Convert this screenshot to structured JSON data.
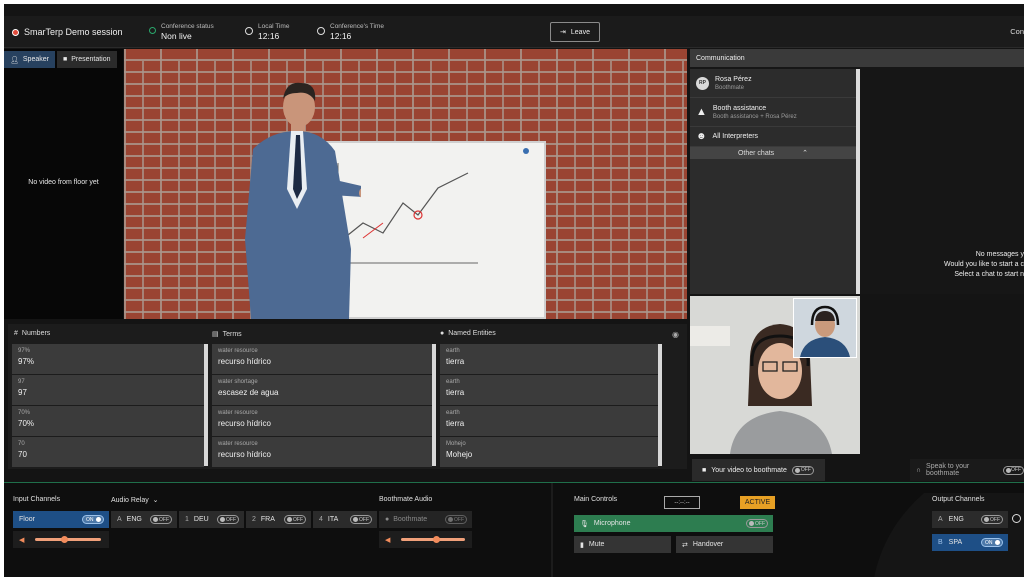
{
  "app": {
    "title": "SmarTerp Demo session"
  },
  "header": {
    "conference_status_label": "Conference status",
    "conference_status_value": "Non live",
    "local_time_label": "Local Time",
    "local_time_value": "12:16",
    "conference_time_label": "Conference's Time",
    "conference_time_value": "12:16",
    "leave_label": "Leave",
    "right_cut_label": "Con"
  },
  "left_panel": {
    "tabs": [
      {
        "label": "Speaker",
        "active": true
      },
      {
        "label": "Presentation",
        "active": false
      }
    ],
    "no_video_text": "No video from floor yet"
  },
  "communication": {
    "title": "Communication",
    "items": [
      {
        "name": "Rosa Pérez",
        "sub": "Boothmate",
        "avatar": "RP"
      },
      {
        "name": "Booth assistance",
        "sub": "Booth assistance + Rosa Pérez",
        "icon": "warning-icon"
      },
      {
        "name": "All Interpreters",
        "sub": "",
        "icon": "group-icon"
      }
    ],
    "other_chats_label": "Other chats",
    "no_messages_lines": [
      "No messages y",
      "Would you like to start a c",
      "Select a chat to start n"
    ]
  },
  "glossary": {
    "columns": [
      {
        "title": "Numbers",
        "icon": "hash-icon",
        "rows": [
          {
            "k": "97%",
            "v": "97%"
          },
          {
            "k": "97",
            "v": "97"
          },
          {
            "k": "70%",
            "v": "70%"
          },
          {
            "k": "70",
            "v": "70"
          }
        ]
      },
      {
        "title": "Terms",
        "icon": "book-icon",
        "rows": [
          {
            "k": "water resource",
            "v": "recurso hídrico"
          },
          {
            "k": "water shortage",
            "v": "escasez de agua"
          },
          {
            "k": "water resource",
            "v": "recurso hídrico"
          },
          {
            "k": "water resource",
            "v": "recurso hídrico"
          }
        ]
      },
      {
        "title": "Named Entities",
        "icon": "globe-icon",
        "rows": [
          {
            "k": "earth",
            "v": "tierra"
          },
          {
            "k": "earth",
            "v": "tierra"
          },
          {
            "k": "earth",
            "v": "tierra"
          },
          {
            "k": "Mohejo",
            "v": "Mohejo"
          }
        ]
      }
    ]
  },
  "video_controls": {
    "your_video_label": "Your video to boothmate",
    "your_video_toggle": "OFF",
    "speak_label": "Speak to your boothmate",
    "speak_toggle": "OFF"
  },
  "bottom": {
    "input_channels_label": "Input Channels",
    "floor_label": "Floor",
    "floor_toggle": "ON",
    "audio_relay_label": "Audio Relay",
    "relays": [
      {
        "prefix": "A",
        "lang": "ENG",
        "toggle": "OFF"
      },
      {
        "prefix": "1",
        "lang": "DEU",
        "toggle": "OFF"
      },
      {
        "prefix": "2",
        "lang": "FRA",
        "toggle": "OFF"
      },
      {
        "prefix": "4",
        "lang": "ITA",
        "toggle": "OFF"
      }
    ],
    "boothmate_audio_label": "Boothmate Audio",
    "boothmate_label": "Boothmate",
    "boothmate_toggle": "OFF",
    "main_controls_label": "Main Controls",
    "timer_value": "--:--:--",
    "active_label": "ACTIVE",
    "microphone_label": "Microphone",
    "microphone_toggle": "OFF",
    "mute_label": "Mute",
    "handover_label": "Handover",
    "output_channels_label": "Output Channels",
    "outputs": [
      {
        "prefix": "A",
        "lang": "ENG",
        "toggle": "OFF"
      },
      {
        "prefix": "B",
        "lang": "SPA",
        "toggle": "ON"
      }
    ],
    "floor_volume": 0.45,
    "boothmate_volume": 0.55
  },
  "colors": {
    "accent_blue": "#1e4f86",
    "accent_green": "#2d7d50",
    "active_orange": "#e7a024"
  }
}
